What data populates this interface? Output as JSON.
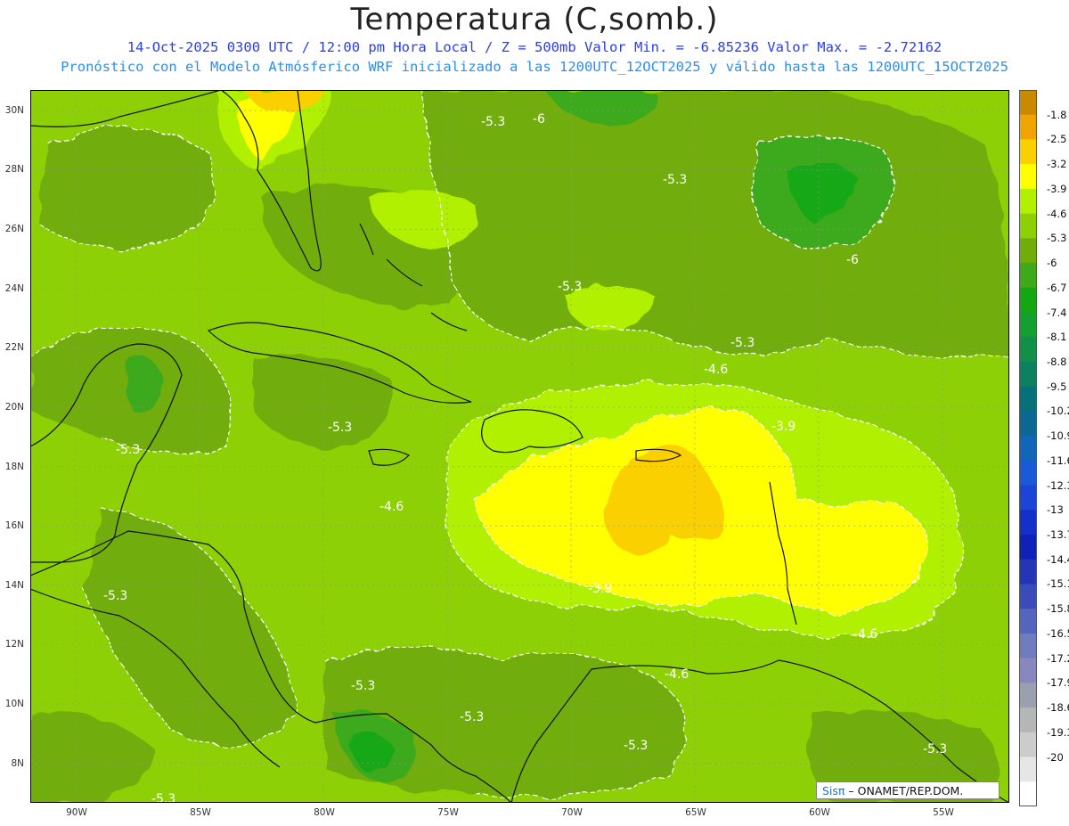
{
  "header": {
    "title": "Temperatura (C,somb.)",
    "line1": "14-Oct-2025  0300 UTC / 12:00 pm Hora Local / Z = 500mb  Valor Min. = -6.85236  Valor Max. = -2.72162",
    "line2": "Pronóstico con el Modelo Atmósferico WRF inicializado a las 1200UTC_12OCT2025 y válido hasta las  1200UTC_15OCT2025"
  },
  "map": {
    "lat_labels": [
      "30N",
      "28N",
      "26N",
      "24N",
      "22N",
      "20N",
      "18N",
      "16N",
      "14N",
      "12N",
      "10N",
      "8N"
    ],
    "lon_labels": [
      "90W",
      "85W",
      "80W",
      "75W",
      "70W",
      "65W",
      "60W",
      "55W"
    ],
    "contour_labels": [
      "-5.3",
      "-6",
      "-5.3",
      "-5.3",
      "-6",
      "-5.3",
      "-4.6",
      "-5.3",
      "-5.3",
      "-3.9",
      "-4.6",
      "-3.9",
      "-5.3",
      "-4.6",
      "-4.6",
      "-5.3",
      "-5.3",
      "-5.3",
      "-5.3",
      "-5.3"
    ],
    "colors": {
      "c_m67": "#13a813",
      "c_m60": "#3ea91b",
      "c_m53": "#70ad08",
      "c_m46": "#8dd005",
      "c_m39": "#b0f000",
      "c_m32": "#ffff00",
      "c_m25": "#fbd000",
      "c_m18": "#f0a400",
      "coast": "#111111",
      "contour": "#ffffff"
    }
  },
  "colorbar": {
    "labels": [
      "-1.8",
      "-2.5",
      "-3.2",
      "-3.9",
      "-4.6",
      "-5.3",
      "-6",
      "-6.7",
      "-7.4",
      "-8.1",
      "-8.8",
      "-9.5",
      "-10.2",
      "-10.9",
      "-11.6",
      "-12.3",
      "-13",
      "-13.7",
      "-14.4",
      "-15.1",
      "-15.8",
      "-16.5",
      "-17.2",
      "-17.9",
      "-18.6",
      "-19.3",
      "-20"
    ],
    "colors": [
      "#c98a00",
      "#f0a400",
      "#fbd000",
      "#ffff00",
      "#b0f000",
      "#8dd005",
      "#70ad08",
      "#3ea91b",
      "#13a813",
      "#14a02e",
      "#129048",
      "#0d8060",
      "#087078",
      "#0b6892",
      "#1166b8",
      "#1a5ad8",
      "#1c44d6",
      "#1530c8",
      "#0f22b8",
      "#2436b6",
      "#3a4cb8",
      "#5565bc",
      "#6f7cbe",
      "#8a86c0",
      "#9aa0b0",
      "#b4b6b8",
      "#cccccc",
      "#e6e6e6",
      "#ffffff"
    ]
  },
  "credit": {
    "brand": "Sisπ",
    "text": " – ONAMET/REP.DOM."
  }
}
